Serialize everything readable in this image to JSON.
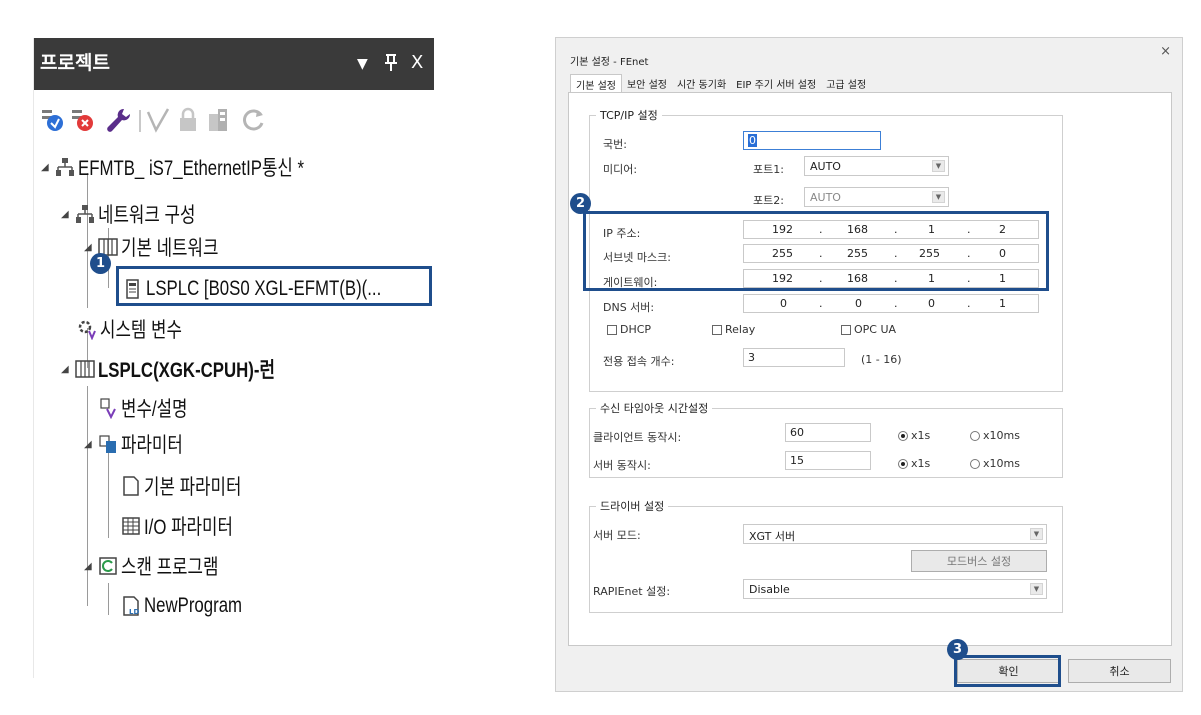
{
  "project_panel": {
    "title": "프로젝트",
    "header_buttons": {
      "dropdown": "▼",
      "pin": "ㅍ",
      "close": "X"
    },
    "tree": {
      "root": "EFMTB_ iS7_EthernetIP통신 *",
      "network_config": "네트워크 구성",
      "basic_network": "기본 네트워크",
      "lsplc_module": "LSPLC [B0S0 XGL-EFMT(B)(...",
      "system_vars": "시스템 변수",
      "cpu": "LSPLC(XGK-CPUH)-런",
      "vars_desc": "변수/설명",
      "parameters": "파라미터",
      "basic_param": "기본 파라미터",
      "io_param": "I/O 파라미터",
      "scan_program": "스캔 프로그램",
      "new_program": "NewProgram"
    }
  },
  "badges": {
    "one": "1",
    "two": "2",
    "three": "3"
  },
  "dialog": {
    "title": "기본 설정 - FEnet",
    "close": "×",
    "tabs": [
      "기본 설정",
      "보안 설정",
      "시간 동기화",
      "EIP 주기 서버 설정",
      "고급 설정"
    ],
    "tcpip": {
      "legend": "TCP/IP 설정",
      "station_label": "국번:",
      "station_value": "0",
      "media_label": "미디어:",
      "port1_label": "포트1:",
      "port1_value": "AUTO",
      "port2_label": "포트2:",
      "port2_value": "AUTO",
      "ip_label": "IP 주소:",
      "ip": [
        "192",
        "168",
        "1",
        "2"
      ],
      "subnet_label": "서브넷 마스크:",
      "subnet": [
        "255",
        "255",
        "255",
        "0"
      ],
      "gateway_label": "게이트웨이:",
      "gateway": [
        "192",
        "168",
        "1",
        "1"
      ],
      "dns_label": "DNS 서버:",
      "dns": [
        "0",
        "0",
        "0",
        "1"
      ],
      "dot": ".",
      "dhcp": "DHCP",
      "relay": "Relay",
      "opcua": "OPC UA",
      "conn_label": "전용 접속 개수:",
      "conn_value": "3",
      "conn_range": "(1 - 16)"
    },
    "timeout": {
      "legend": "수신 타임아웃 시간설정",
      "client_label": "클라이언트 동작시:",
      "client_value": "60",
      "server_label": "서버 동작시:",
      "server_value": "15",
      "x1s": "x1s",
      "x10ms": "x10ms"
    },
    "driver": {
      "legend": "드라이버 설정",
      "server_mode_label": "서버 모드:",
      "server_mode_value": "XGT 서버",
      "modbus_button": "모드버스 설정",
      "rapienet_label": "RAPIEnet 설정:",
      "rapienet_value": "Disable"
    },
    "ok": "확인",
    "cancel": "취소"
  }
}
